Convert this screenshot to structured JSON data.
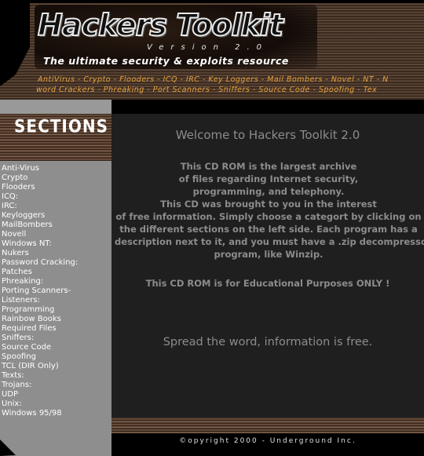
{
  "header": {
    "title": "Hackers Toolkit",
    "version": "Version 2.0",
    "tagline": "The ultimate security & exploits resource"
  },
  "nav": {
    "row1": [
      "AntiVirus",
      "Crypto",
      "Flooders",
      "ICQ",
      "IRC",
      "Key Loggers",
      "Mail Bombers",
      "Novel",
      "NT",
      "N"
    ],
    "row2": [
      "word Crackers",
      "Phreaking",
      "Port Scanners",
      "Sniffers",
      "Source Code",
      "Spoofing",
      "Tex"
    ]
  },
  "sidebar": {
    "title": "SECTIONS",
    "items": [
      "Anti-Virus",
      "Crypto",
      "Flooders",
      "ICQ:",
      "IRC:",
      "Keyloggers",
      "MailBombers",
      "Novell",
      "Windows NT:",
      "Nukers",
      "Password Cracking:",
      "Patches",
      "Phreaking:",
      "Porting Scanners-",
      "Listeners:",
      "Programming",
      "Rainbow Books",
      "Required Files",
      "Sniffers:",
      "Source Code",
      "Spoofing",
      "TCL (DIR Only)",
      "Texts:",
      "Trojans:",
      "UDP",
      "Unix:",
      "Windows 95/98"
    ]
  },
  "main": {
    "welcome": "Welcome to Hackers Toolkit 2.0",
    "intro_lines": [
      "This CD ROM is the largest archive",
      "of files regarding Internet security,",
      "programming, and telephony.",
      "This CD was brought to you in the interest",
      "of free information. Simply choose a categort by clicking on",
      "the different sections on the left side. Each program has a",
      "description next to it, and you must have a .zip decompressor",
      "program, like Winzip."
    ],
    "educational": "This CD ROM is for Educational Purposes ONLY !",
    "spread": "Spread the word, information is free."
  },
  "footer": {
    "copyright": "©opyright 2000 - Underground Inc."
  },
  "colors": {
    "nav_text": "#e6a23c",
    "sidebar_bg": "#8e8e8e",
    "main_bg": "#1f1f1f",
    "main_text": "#8c8c8c"
  }
}
